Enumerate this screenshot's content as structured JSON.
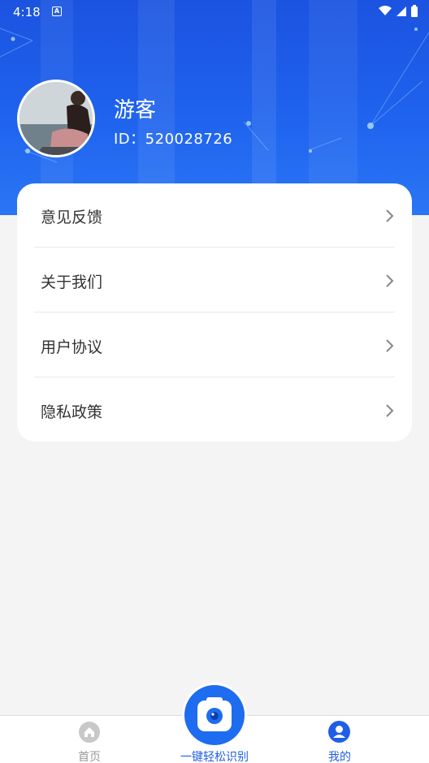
{
  "status_bar": {
    "time": "4:18"
  },
  "profile": {
    "username": "游客",
    "id_text": "ID：520028726"
  },
  "menu": [
    {
      "label": "意见反馈"
    },
    {
      "label": "关于我们"
    },
    {
      "label": "用户协议"
    },
    {
      "label": "隐私政策"
    }
  ],
  "bottom_nav": {
    "home_label": "首页",
    "scan_label": "一键轻松识别",
    "mine_label": "我的"
  },
  "colors": {
    "accent": "#1f5fe8",
    "header": "#1b53e0"
  },
  "icons": [
    "home-icon",
    "camera-icon",
    "user-icon",
    "chevron-right-icon",
    "wifi-icon",
    "signal-icon",
    "battery-icon"
  ]
}
